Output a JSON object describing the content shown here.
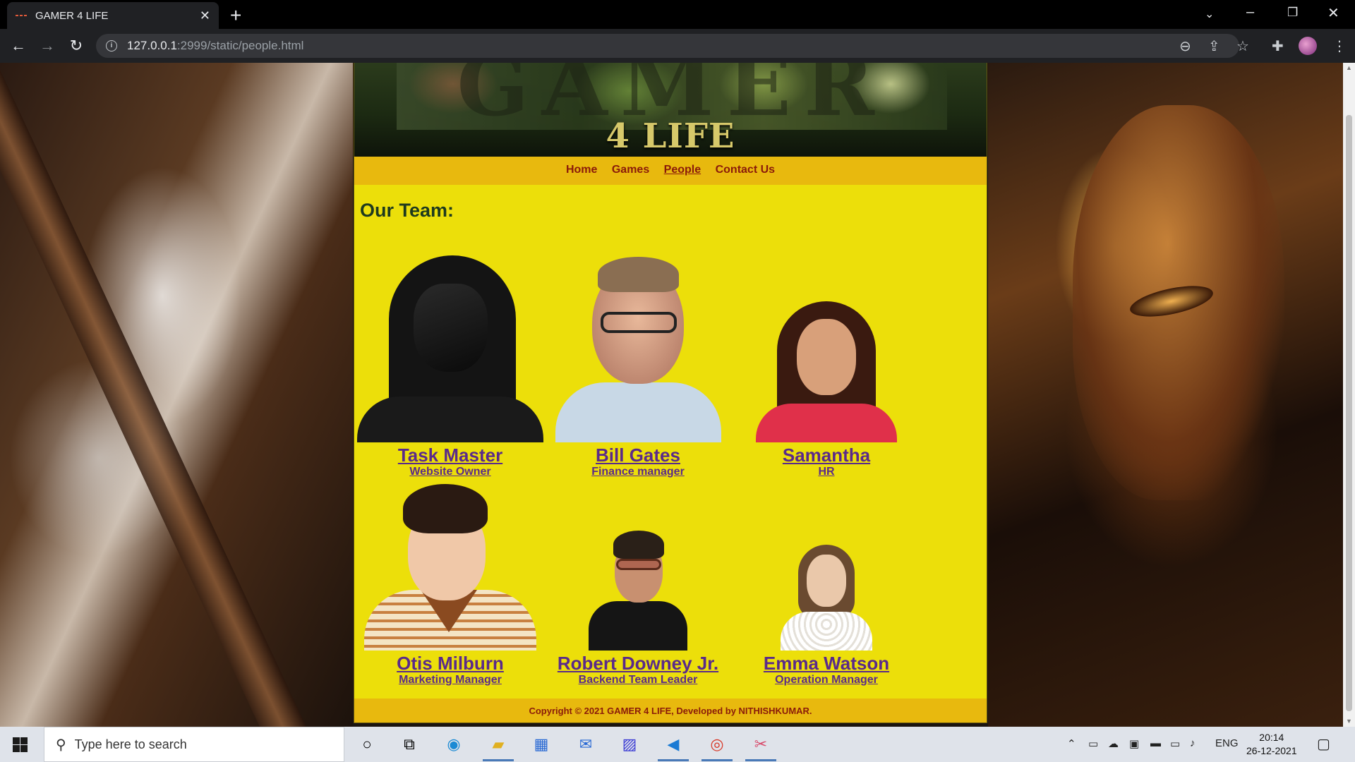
{
  "browser": {
    "tab_title": "GAMER 4 LIFE",
    "url_host": "127.0.0.1",
    "url_rest": ":2999/static/people.html"
  },
  "site": {
    "logo_text": "4 LIFE",
    "banner_word": "GAMER",
    "nav": [
      {
        "label": "Home",
        "active": false
      },
      {
        "label": "Games",
        "active": false
      },
      {
        "label": "People",
        "active": true
      },
      {
        "label": "Contact Us",
        "active": false
      }
    ],
    "heading": "Our Team:",
    "team": [
      {
        "name": "Task Master",
        "role": "Website Owner"
      },
      {
        "name": "Bill Gates",
        "role": "Finance manager"
      },
      {
        "name": "Samantha",
        "role": "HR"
      },
      {
        "name": "Otis Milburn",
        "role": "Marketing Manager"
      },
      {
        "name": "Robert Downey Jr.",
        "role": "Backend Team Leader"
      },
      {
        "name": "Emma Watson",
        "role": "Operation Manager"
      }
    ],
    "footer": "Copyright © 2021 GAMER 4 LIFE, Developed by NITHISHKUMAR."
  },
  "taskbar": {
    "search_placeholder": "Type here to search",
    "language": "ENG",
    "time": "20:14",
    "date": "26-12-2021"
  },
  "colors": {
    "page_background": "#ecdf0a",
    "nav_background": "#e8b90e",
    "nav_link": "#8a1a0a",
    "heading": "#1e3a1e",
    "member_link": "#5a2a8a"
  }
}
